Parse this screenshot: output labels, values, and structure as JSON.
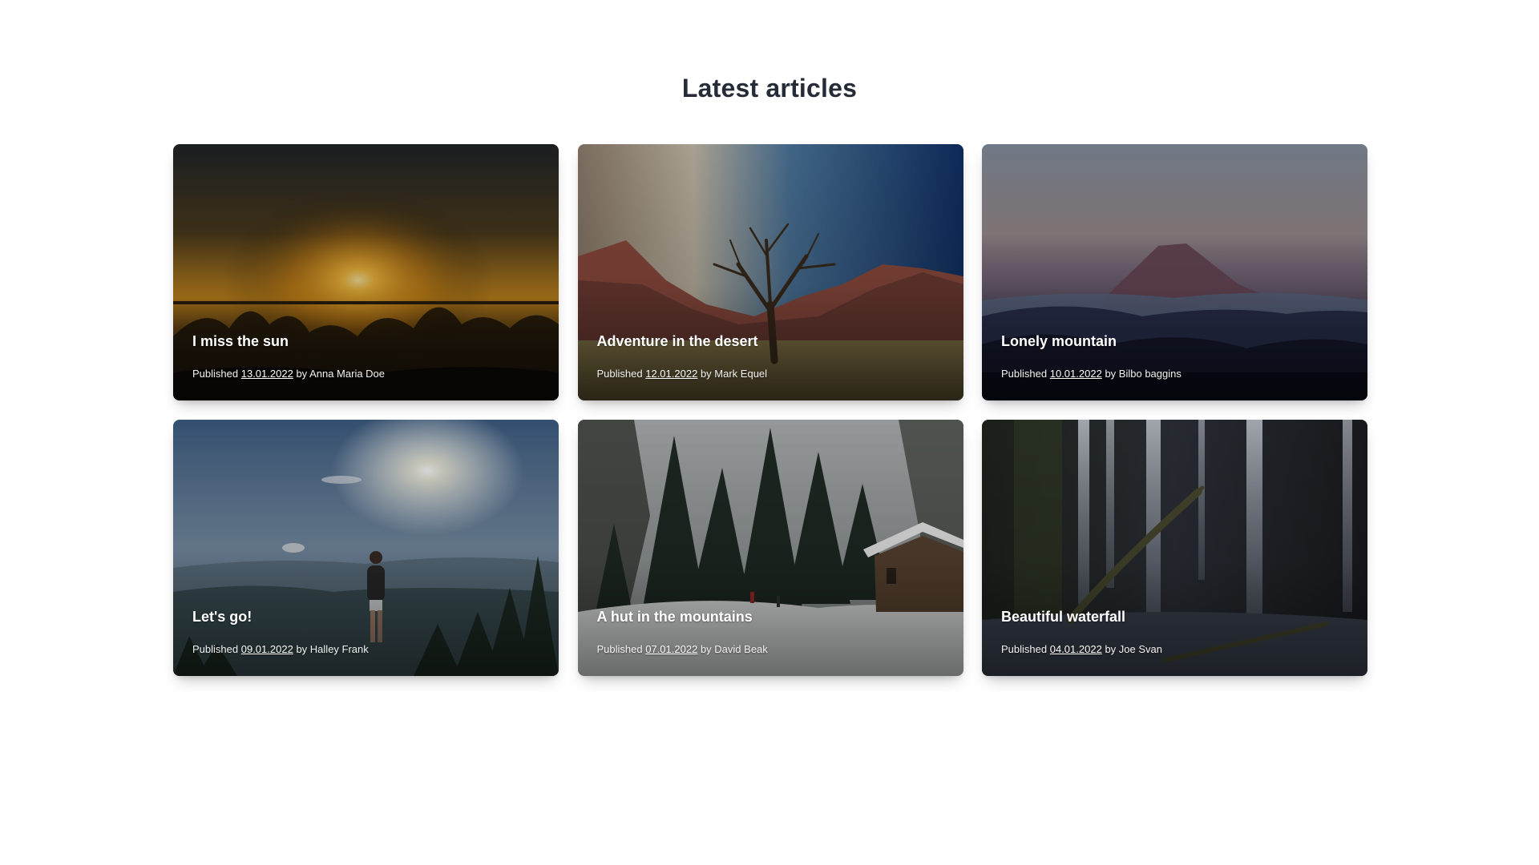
{
  "page": {
    "title": "Latest articles"
  },
  "articles": [
    {
      "title": "I miss the sun",
      "published_label": "Published",
      "date": "13.01.2022",
      "by_label": "by",
      "author": "Anna Maria Doe",
      "image": "sunset-waves-image"
    },
    {
      "title": "Adventure in the desert",
      "published_label": "Published",
      "date": "12.01.2022",
      "by_label": "by",
      "author": "Mark Equel",
      "image": "desert-tree-image"
    },
    {
      "title": "Lonely mountain",
      "published_label": "Published",
      "date": "10.01.2022",
      "by_label": "by",
      "author": "Bilbo baggins",
      "image": "mountain-dusk-image"
    },
    {
      "title": "Let's go!",
      "published_label": "Published",
      "date": "09.01.2022",
      "by_label": "by",
      "author": "Halley Frank",
      "image": "hiker-valley-image"
    },
    {
      "title": "A hut in the mountains",
      "published_label": "Published",
      "date": "07.01.2022",
      "by_label": "by",
      "author": "David Beak",
      "image": "snowy-hut-image"
    },
    {
      "title": "Beautiful waterfall",
      "published_label": "Published",
      "date": "04.01.2022",
      "by_label": "by",
      "author": "Joe Svan",
      "image": "waterfall-image"
    }
  ],
  "colors": {
    "heading": "#252c38",
    "caption": "#ffffff"
  }
}
